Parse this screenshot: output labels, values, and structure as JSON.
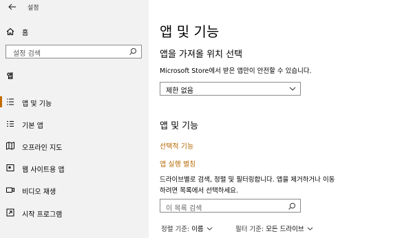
{
  "window": {
    "title": "설정"
  },
  "sidebar": {
    "home_label": "홈",
    "search_placeholder": "설정 검색",
    "group_label": "앱",
    "items": [
      {
        "label": "앱 및 기능",
        "icon": "apps-list-icon",
        "active": true
      },
      {
        "label": "기본 앱",
        "icon": "default-apps-icon",
        "active": false
      },
      {
        "label": "오프라인 지도",
        "icon": "map-icon",
        "active": false
      },
      {
        "label": "웹 사이트용 앱",
        "icon": "web-apps-icon",
        "active": false
      },
      {
        "label": "비디오 재생",
        "icon": "video-icon",
        "active": false
      },
      {
        "label": "시작 프로그램",
        "icon": "startup-icon",
        "active": false
      }
    ]
  },
  "main": {
    "page_title": "앱 및 기능",
    "install_section": {
      "heading": "앱을 가져올 위치 선택",
      "description": "Microsoft Store에서 받은 앱만이 안전할 수 있습니다.",
      "dropdown_value": "제한 없음"
    },
    "apps_section": {
      "heading": "앱 및 기능",
      "links": [
        "선택적 기능",
        "앱 실행 별칭"
      ],
      "description_line1": "드라이브별로 검색, 정렬 및 필터링합니다. 앱을 제거하거나 이동",
      "description_line2": "하려면 목록에서 선택하세요.",
      "search_placeholder": "이 목록 검색",
      "sort_key": "정렬 기준:",
      "sort_value": "이름",
      "filter_key": "필터 기준:",
      "filter_value": "모든 드라이브"
    }
  },
  "colors": {
    "sidebar_bg": "#f2f2f2",
    "accent": "#c26b00",
    "link": "#b56700"
  }
}
